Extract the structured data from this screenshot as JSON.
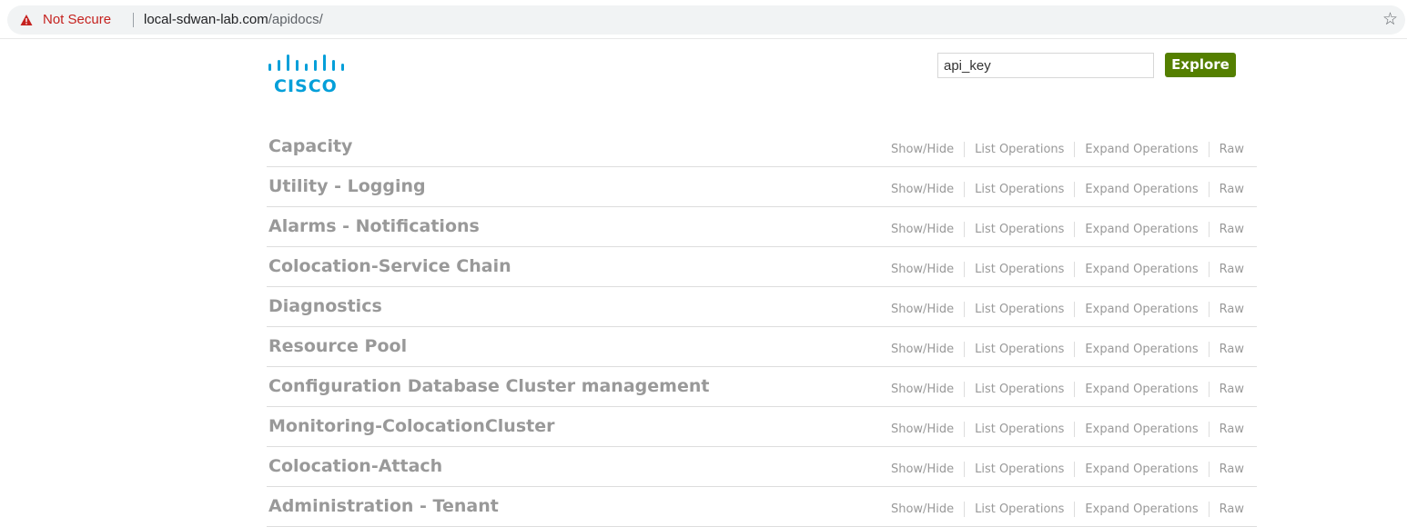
{
  "browser": {
    "security_label": "Not Secure",
    "url_host": "local-sdwan-lab.com",
    "url_path": "/apidocs/",
    "icons": {
      "warning": "warning-triangle-icon",
      "bookmark": "star-icon"
    },
    "security_color": "#c5221f"
  },
  "header": {
    "logo_text": "CISCO",
    "api_key_placeholder": "api_key",
    "explore_label": "Explore",
    "explore_color": "#547f00",
    "logo_color": "#049fd9"
  },
  "operation_labels": {
    "show_hide": "Show/Hide",
    "list": "List Operations",
    "expand": "Expand Operations",
    "raw": "Raw"
  },
  "resources": [
    {
      "title": "Capacity"
    },
    {
      "title": "Utility - Logging"
    },
    {
      "title": "Alarms - Notifications"
    },
    {
      "title": "Colocation-Service Chain"
    },
    {
      "title": "Diagnostics"
    },
    {
      "title": "Resource Pool"
    },
    {
      "title": "Configuration Database Cluster management"
    },
    {
      "title": "Monitoring-ColocationCluster"
    },
    {
      "title": "Colocation-Attach"
    },
    {
      "title": "Administration - Tenant"
    }
  ]
}
